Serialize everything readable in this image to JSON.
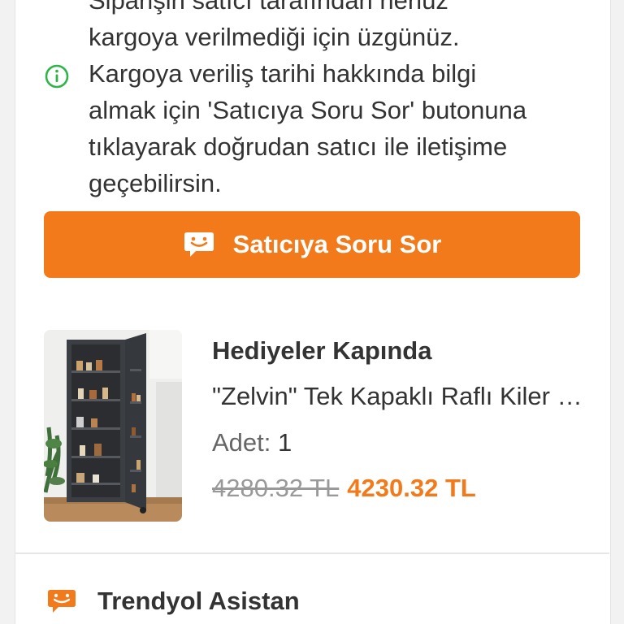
{
  "info": {
    "icon": "info-icon",
    "lines": [
      "Siparişin satıcı tarafından henüz",
      "kargoya verilmediği için üzgünüz.",
      "Kargoya veriliş tarihi hakkında bilgi",
      "almak için 'Satıcıya Soru Sor' butonuna",
      "tıklayarak doğrudan satıcı ile iletişime",
      "geçebilirsin."
    ]
  },
  "ask_button": {
    "icon": "chat-smile-icon",
    "label": "Satıcıya Soru Sor"
  },
  "product": {
    "image": "product-image",
    "seller": "Hediyeler Kapında",
    "title": "\"Zelvin\" Tek Kapaklı Raflı Kiler Dolabı",
    "quantity_label": "Adet:",
    "quantity_value": "1",
    "old_price": "4280.32 TL",
    "new_price": "4230.32 TL"
  },
  "assistant": {
    "icon": "chat-smile-icon",
    "label": "Trendyol Asistan"
  },
  "colors": {
    "accent": "#f27a1a",
    "info_green": "#2fb44a",
    "text": "#333333",
    "muted": "#999999"
  }
}
